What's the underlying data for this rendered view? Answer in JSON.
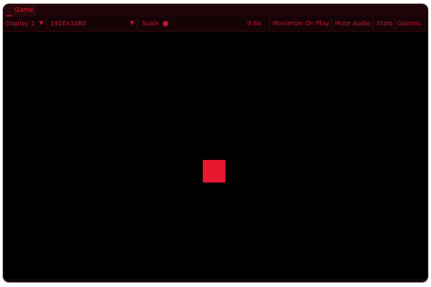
{
  "tab": {
    "icon": "gamepad-icon",
    "label": "Game"
  },
  "toolbar": {
    "display_label": "Display 1",
    "resolution_label": "1920x1080",
    "scale_label": "Scale",
    "scale_value": "0.8x",
    "maximize_label": "Maximize On Play",
    "mute_label": "Mute Audio",
    "stats_label": "Stats",
    "gizmos_label": "Gizmos"
  },
  "colors": {
    "accent": "#c41a31",
    "object": "#e8182f",
    "background": "#000000"
  }
}
